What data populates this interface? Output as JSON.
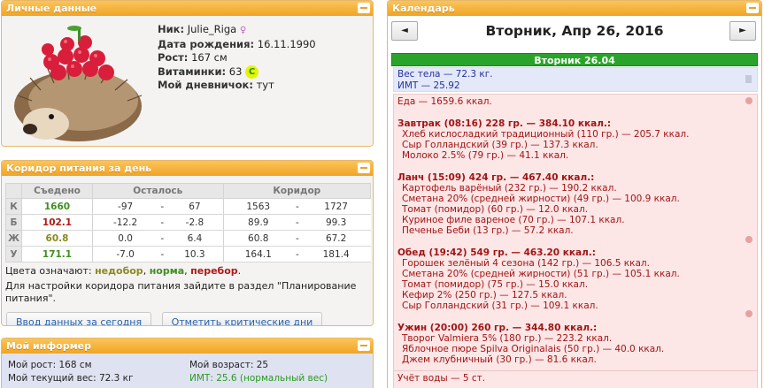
{
  "personal": {
    "title": "Личные данные",
    "nick_label": "Ник:",
    "nick": "Julie_Riga",
    "dob_label": "Дата рождения:",
    "dob": "16.11.1990",
    "height_label": "Рост:",
    "height": "167 см",
    "vit_label": "Витаминки:",
    "vit": "63",
    "vit_badge": "C",
    "diary_label": "Мой дневничок:",
    "diary": "тут"
  },
  "corridor": {
    "title": "Коридор питания за день",
    "headers": [
      "Съедено",
      "Осталось",
      "Коридор"
    ],
    "rows": [
      {
        "label": "К",
        "eaten": "1660",
        "left_min": "-97",
        "left_max": "67",
        "c_min": "1563",
        "c_max": "1727"
      },
      {
        "label": "Б",
        "eaten": "102.1",
        "left_min": "-12.2",
        "left_max": "-2.8",
        "c_min": "89.9",
        "c_max": "99.3"
      },
      {
        "label": "Ж",
        "eaten": "60.8",
        "left_min": "0.0",
        "left_max": "6.4",
        "c_min": "60.8",
        "c_max": "67.2"
      },
      {
        "label": "У",
        "eaten": "171.1",
        "left_min": "-7.0",
        "left_max": "10.3",
        "c_min": "164.1",
        "c_max": "181.4"
      }
    ],
    "dash": "-",
    "legend_prefix": "Цвета означают:",
    "legend_under": "недобор",
    "legend_norm": "норма",
    "legend_over": "перебор",
    "hint": "Для настройки коридора питания зайдите в раздел \"Планирование питания\".",
    "btn_enter": "Ввод данных за сегодня",
    "btn_critical": "Отметить критические дни"
  },
  "informer": {
    "title": "Мой информер",
    "height": "Мой рост: 168 см",
    "weight": "Мой текущий вес: 72.3 кг",
    "age": "Мой возраст: 25",
    "bmi": "ИМТ: 25.6 (нормальный вес)"
  },
  "calendar": {
    "title": "Календарь",
    "prev": "◄",
    "next": "►",
    "date": "Вторник, Апр 26, 2016",
    "day_header": "Вторник 26.04",
    "weight": "Вес тела — 72.3 кг.",
    "bmi": "ИМТ — 25.92",
    "food_total": "Еда — 1659.6 ккал.",
    "meals": [
      {
        "title": "Завтрак (08:16) 228 гр. — 384.10 ккал.:",
        "items": [
          "Хлеб кисло­сладкий традиционный (110 гр.) — 205.7 ккал.",
          "Сыр Голландский (39 гр.) — 137.3 ккал.",
          "Молоко 2.5% (79 гр.) — 41.1 ккал."
        ]
      },
      {
        "title": "Ланч (15:09) 424 гр. — 467.40 ккал.:",
        "items": [
          "Картофель варёный (232 гр.) — 190.2 ккал.",
          "Сметана 20% (средней жирности) (49 гр.) — 100.9 ккал.",
          "Томат (помидор) (60 гр.) — 12.0 ккал.",
          "Куриное филе вареное (70 гр.) — 107.1 ккал.",
          "Печенье Беби (13 гр.) — 57.2 ккал."
        ]
      },
      {
        "title": "Обед (19:42) 549 гр. — 463.20 ккал.:",
        "items": [
          "Горошек зелёный 4 сезона (142 гр.) — 106.5 ккал.",
          "Сметана 20% (средней жирности) (51 гр.) — 105.1 ккал.",
          "Томат (помидор) (75 гр.) — 15.0 ккал.",
          "Кефир 2% (250 гр.) — 127.5 ккал.",
          "Сыр Голландский (31 гр.) — 109.1 ккал."
        ]
      },
      {
        "title": "Ужин (20:00) 260 гр. — 344.80 ккал.:",
        "items": [
          "Творог Valmiera 5% (180 гр.) — 223.2 ккал.",
          "Яблочное пюре Spilva Originalais (50 гр.) — 40.0 ккал.",
          "Джем клубничный (30 гр.) — 81.6 ккал."
        ]
      }
    ],
    "water": "Учёт воды — 5 ст."
  },
  "colors": {
    "accent": "#f0a525",
    "green": "#2aa32a",
    "red": "#b01818",
    "link": "#2a63b0"
  }
}
